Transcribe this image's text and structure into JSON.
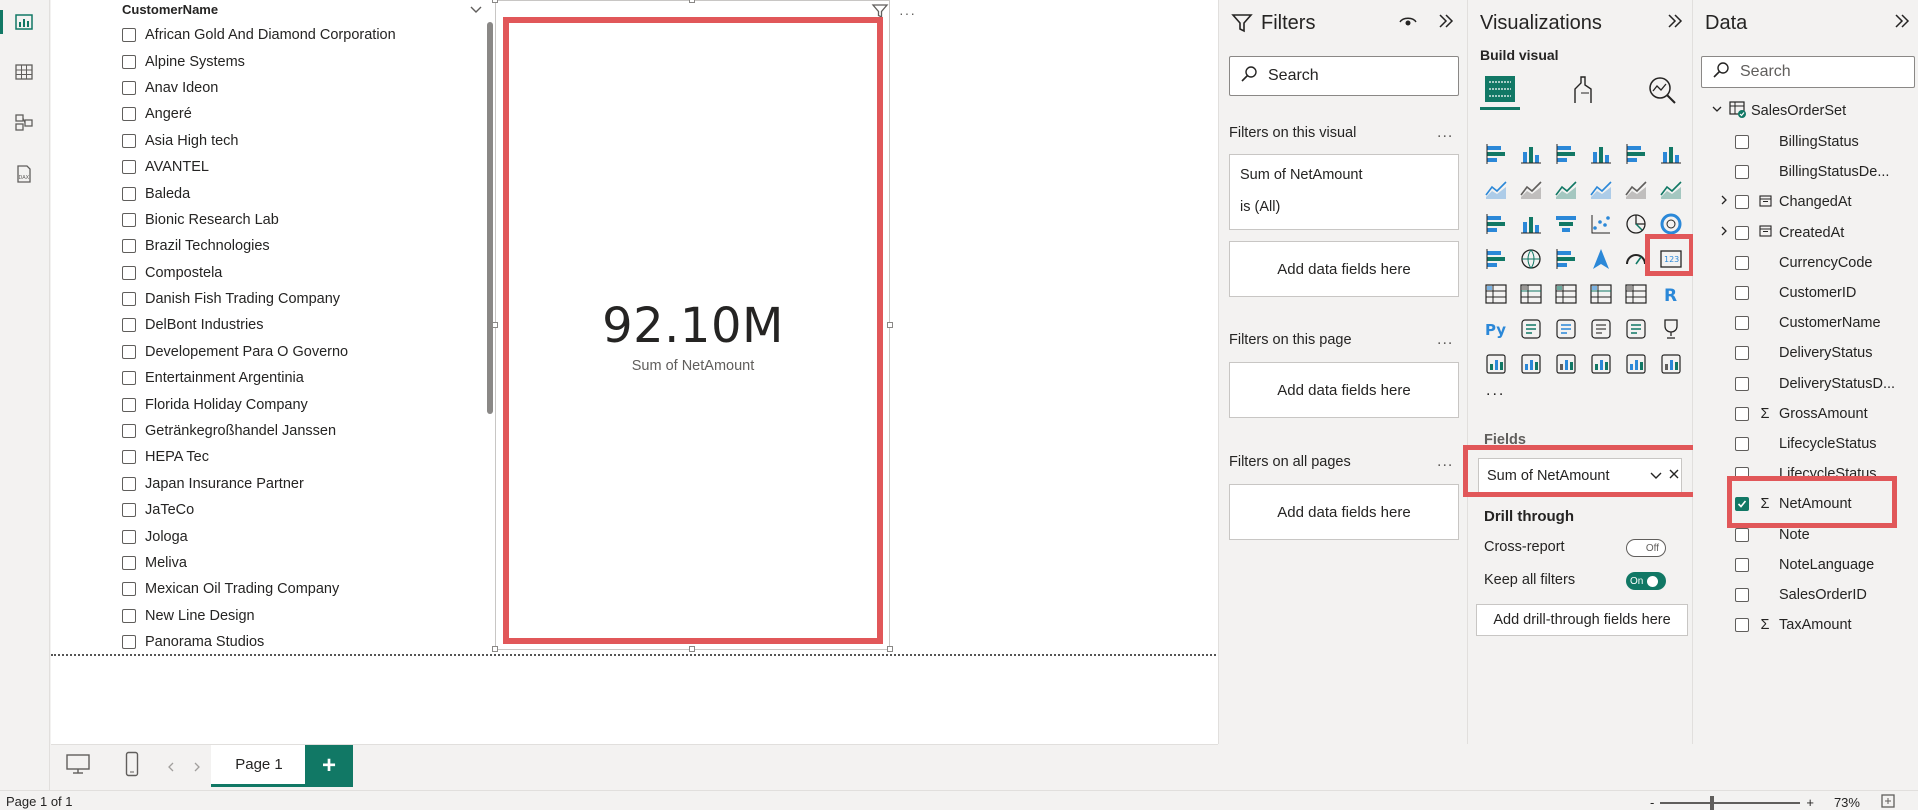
{
  "slicer": {
    "header": "CustomerName",
    "items": [
      "African Gold And Diamond Corporation",
      "Alpine Systems",
      "Anav Ideon",
      "Angeré",
      "Asia High tech",
      "AVANTEL",
      "Baleda",
      "Bionic Research Lab",
      "Brazil Technologies",
      "Compostela",
      "Danish Fish Trading Company",
      "DelBont Industries",
      "Developement Para O Governo",
      "Entertainment Argentinia",
      "Florida Holiday Company",
      "Getränkegroßhandel Janssen",
      "HEPA Tec",
      "Japan Insurance Partner",
      "JaTeCo",
      "Jologa",
      "Meliva",
      "Mexican Oil Trading Company",
      "New Line Design",
      "Panorama Studios"
    ]
  },
  "card": {
    "value": "92.10M",
    "label": "Sum of NetAmount"
  },
  "pages": {
    "tab": "Page 1",
    "add": "+"
  },
  "status": {
    "page_info": "Page 1 of 1",
    "zoom_minus": "-",
    "zoom_plus": "+",
    "zoom_level": "73%"
  },
  "filters": {
    "title": "Filters",
    "search_placeholder": "Search",
    "on_visual": "Filters on this visual",
    "visual_filter_name": "Sum of NetAmount",
    "visual_filter_state": "is (All)",
    "add_fields": "Add data fields here",
    "on_page": "Filters on this page",
    "on_all_pages": "Filters on all pages",
    "dots": "..."
  },
  "visualizations": {
    "title": "Visualizations",
    "build_label": "Build visual",
    "more": "...",
    "fields_label": "Fields",
    "field_value": "Sum of NetAmount",
    "drill_label": "Drill through",
    "cross_report": "Cross-report",
    "cross_report_state": "Off",
    "keep_filters": "Keep all filters",
    "keep_filters_state": "On",
    "add_drill": "Add drill-through fields here"
  },
  "data": {
    "title": "Data",
    "search_placeholder": "Search",
    "table": "SalesOrderSet",
    "fields": [
      {
        "name": "BillingStatus",
        "sigma": false,
        "expand": false,
        "checked": false,
        "calendar": false
      },
      {
        "name": "BillingStatusDe...",
        "sigma": false,
        "expand": false,
        "checked": false,
        "calendar": false
      },
      {
        "name": "ChangedAt",
        "sigma": false,
        "expand": true,
        "checked": false,
        "calendar": true
      },
      {
        "name": "CreatedAt",
        "sigma": false,
        "expand": true,
        "checked": false,
        "calendar": true
      },
      {
        "name": "CurrencyCode",
        "sigma": false,
        "expand": false,
        "checked": false,
        "calendar": false
      },
      {
        "name": "CustomerID",
        "sigma": false,
        "expand": false,
        "checked": false,
        "calendar": false
      },
      {
        "name": "CustomerName",
        "sigma": false,
        "expand": false,
        "checked": false,
        "calendar": false
      },
      {
        "name": "DeliveryStatus",
        "sigma": false,
        "expand": false,
        "checked": false,
        "calendar": false
      },
      {
        "name": "DeliveryStatusD...",
        "sigma": false,
        "expand": false,
        "checked": false,
        "calendar": false
      },
      {
        "name": "GrossAmount",
        "sigma": true,
        "expand": false,
        "checked": false,
        "calendar": false
      },
      {
        "name": "LifecycleStatus",
        "sigma": false,
        "expand": false,
        "checked": false,
        "calendar": false
      },
      {
        "name": "LifecycleStatus...",
        "sigma": false,
        "expand": false,
        "checked": false,
        "calendar": false
      },
      {
        "name": "NetAmount",
        "sigma": true,
        "expand": false,
        "checked": true,
        "calendar": false
      },
      {
        "name": "Note",
        "sigma": false,
        "expand": false,
        "checked": false,
        "calendar": false
      },
      {
        "name": "NoteLanguage",
        "sigma": false,
        "expand": false,
        "checked": false,
        "calendar": false
      },
      {
        "name": "SalesOrderID",
        "sigma": false,
        "expand": false,
        "checked": false,
        "calendar": false
      },
      {
        "name": "TaxAmount",
        "sigma": true,
        "expand": false,
        "checked": false,
        "calendar": false
      }
    ]
  },
  "colors": {
    "accent": "#117865",
    "highlight": "#e15759"
  }
}
